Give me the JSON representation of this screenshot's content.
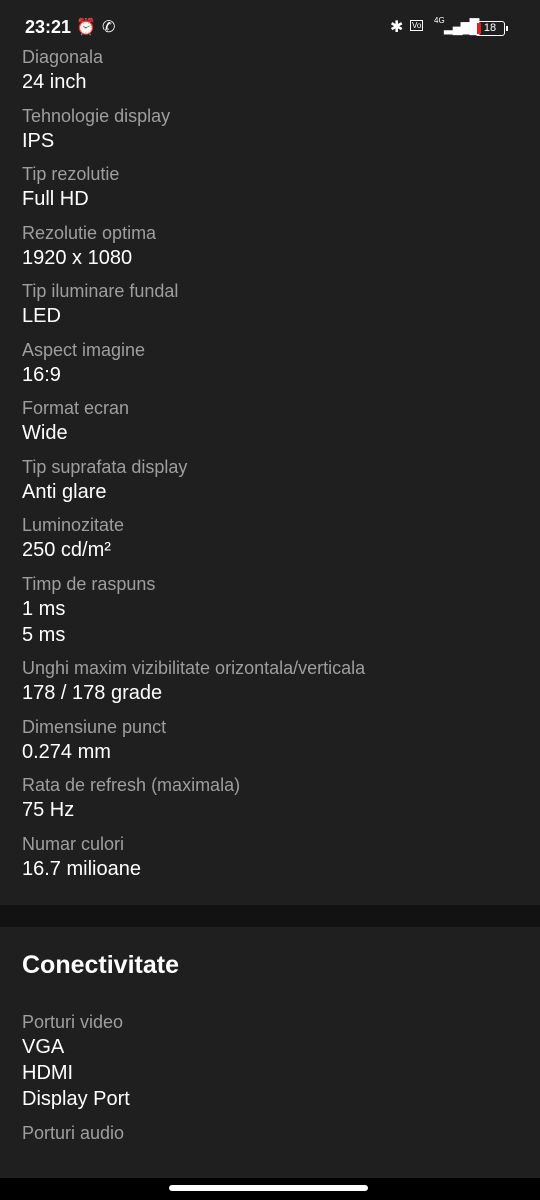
{
  "status_bar": {
    "time": "23:21",
    "battery": "18",
    "network": "4G",
    "icons": [
      "alarm-icon",
      "whatsapp-icon",
      "bluetooth-icon",
      "volte-icon",
      "signal-icon",
      "battery-icon"
    ]
  },
  "specs": [
    {
      "label": "Diagonala",
      "values": [
        "24 inch"
      ]
    },
    {
      "label": "Tehnologie display",
      "values": [
        "IPS"
      ]
    },
    {
      "label": "Tip rezolutie",
      "values": [
        "Full HD"
      ]
    },
    {
      "label": "Rezolutie optima",
      "values": [
        "1920 x 1080"
      ]
    },
    {
      "label": "Tip iluminare fundal",
      "values": [
        "LED"
      ]
    },
    {
      "label": "Aspect imagine",
      "values": [
        "16:9"
      ]
    },
    {
      "label": "Format ecran",
      "values": [
        "Wide"
      ]
    },
    {
      "label": "Tip suprafata display",
      "values": [
        "Anti glare"
      ]
    },
    {
      "label": "Luminozitate",
      "values": [
        "250 cd/m²"
      ]
    },
    {
      "label": "Timp de raspuns",
      "values": [
        "1 ms",
        "5 ms"
      ]
    },
    {
      "label": "Unghi maxim vizibilitate orizontala/verticala",
      "values": [
        "178 / 178 grade"
      ]
    },
    {
      "label": "Dimensiune punct",
      "values": [
        "0.274 mm"
      ]
    },
    {
      "label": "Rata de refresh (maximala)",
      "values": [
        "75 Hz"
      ]
    },
    {
      "label": "Numar culori",
      "values": [
        "16.7 milioane"
      ]
    }
  ],
  "connectivity": {
    "title": "Conectivitate",
    "specs": [
      {
        "label": "Porturi video",
        "values": [
          "VGA",
          "HDMI",
          "Display Port"
        ]
      },
      {
        "label": "Porturi audio",
        "values": []
      }
    ]
  }
}
